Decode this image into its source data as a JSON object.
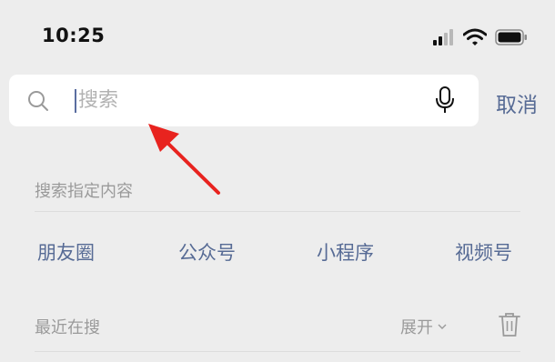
{
  "status_bar": {
    "time": "10:25"
  },
  "search": {
    "placeholder": "搜索",
    "value": ""
  },
  "cancel_label": "取消",
  "section_title": "搜索指定内容",
  "categories": [
    "朋友圈",
    "公众号",
    "小程序",
    "视频号"
  ],
  "recent": {
    "title": "最近在搜",
    "expand_label": "展开"
  },
  "colors": {
    "link": "#576b95",
    "background": "#ededed",
    "arrow": "#e8231f"
  },
  "icons": [
    "search-icon",
    "mic-icon",
    "chevron-down-icon",
    "trash-icon",
    "signal-icon",
    "wifi-icon",
    "battery-icon"
  ]
}
